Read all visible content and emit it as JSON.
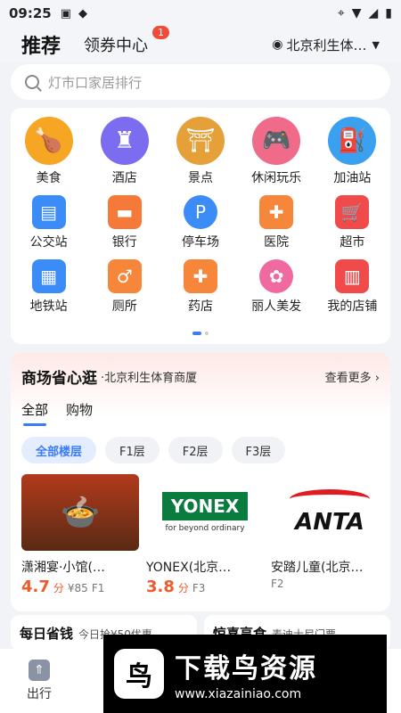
{
  "status": {
    "time": "09:25"
  },
  "header": {
    "tab_recommend": "推荐",
    "tab_coupon": "领券中心",
    "coupon_badge": "1",
    "location": "北京利生体…"
  },
  "search": {
    "placeholder": "灯市口家居排行"
  },
  "grid": {
    "row1": [
      {
        "label": "美食",
        "icon": "food-icon",
        "color": "#f6a623"
      },
      {
        "label": "酒店",
        "icon": "hotel-icon",
        "color": "#7b6cf0"
      },
      {
        "label": "景点",
        "icon": "scenic-icon",
        "color": "#e6a03a"
      },
      {
        "label": "休闲玩乐",
        "icon": "gamepad-icon",
        "color": "#f06a8a"
      },
      {
        "label": "加油站",
        "icon": "gas-station-icon",
        "color": "#3aa0f0"
      }
    ],
    "row2": [
      {
        "label": "公交站",
        "icon": "bus-stop-icon",
        "color": "#3b8cf6"
      },
      {
        "label": "银行",
        "icon": "bank-card-icon",
        "color": "#f57a3a"
      },
      {
        "label": "停车场",
        "icon": "parking-icon",
        "color": "#3b8cf6"
      },
      {
        "label": "医院",
        "icon": "hospital-icon",
        "color": "#f5863a"
      },
      {
        "label": "超市",
        "icon": "cart-icon",
        "color": "#f04a4a"
      }
    ],
    "row3": [
      {
        "label": "地铁站",
        "icon": "subway-icon",
        "color": "#3b8cf6"
      },
      {
        "label": "厕所",
        "icon": "toilet-icon",
        "color": "#f5863a"
      },
      {
        "label": "药店",
        "icon": "pharmacy-icon",
        "color": "#f5863a"
      },
      {
        "label": "丽人美发",
        "icon": "beauty-icon",
        "color": "#f06aa0"
      },
      {
        "label": "我的店铺",
        "icon": "my-shop-icon",
        "color": "#f04a4a"
      }
    ]
  },
  "mall": {
    "title": "商场省心逛",
    "subtitle": "·北京利生体育商厦",
    "more": "查看更多",
    "tabs": [
      "全部",
      "购物"
    ],
    "floors": [
      "全部楼层",
      "F1层",
      "F2层",
      "F3层"
    ],
    "shops": [
      {
        "name": "潇湘宴·小馆(…",
        "score": "4.7",
        "score_unit": "分",
        "price": "¥85",
        "floor": "F1"
      },
      {
        "name": "YONEX(北京…",
        "score": "3.8",
        "score_unit": "分",
        "price": "",
        "floor": "F3",
        "logo_text": "YONEX",
        "logo_sub": "for beyond ordinary"
      },
      {
        "name": "安踏儿童(北京…",
        "score": "",
        "score_unit": "",
        "price": "",
        "floor": "F2",
        "logo_text": "ANTA"
      }
    ]
  },
  "bottom_cards": [
    {
      "title": "每日省钱",
      "sub": "今日抢¥50优惠"
    },
    {
      "title": "惊喜享食",
      "sub": "麦迪士尼门票"
    }
  ],
  "nav": {
    "travel": "出行"
  },
  "watermark": {
    "title": "下载鸟资源",
    "url": "www.xiazainiao.com"
  }
}
